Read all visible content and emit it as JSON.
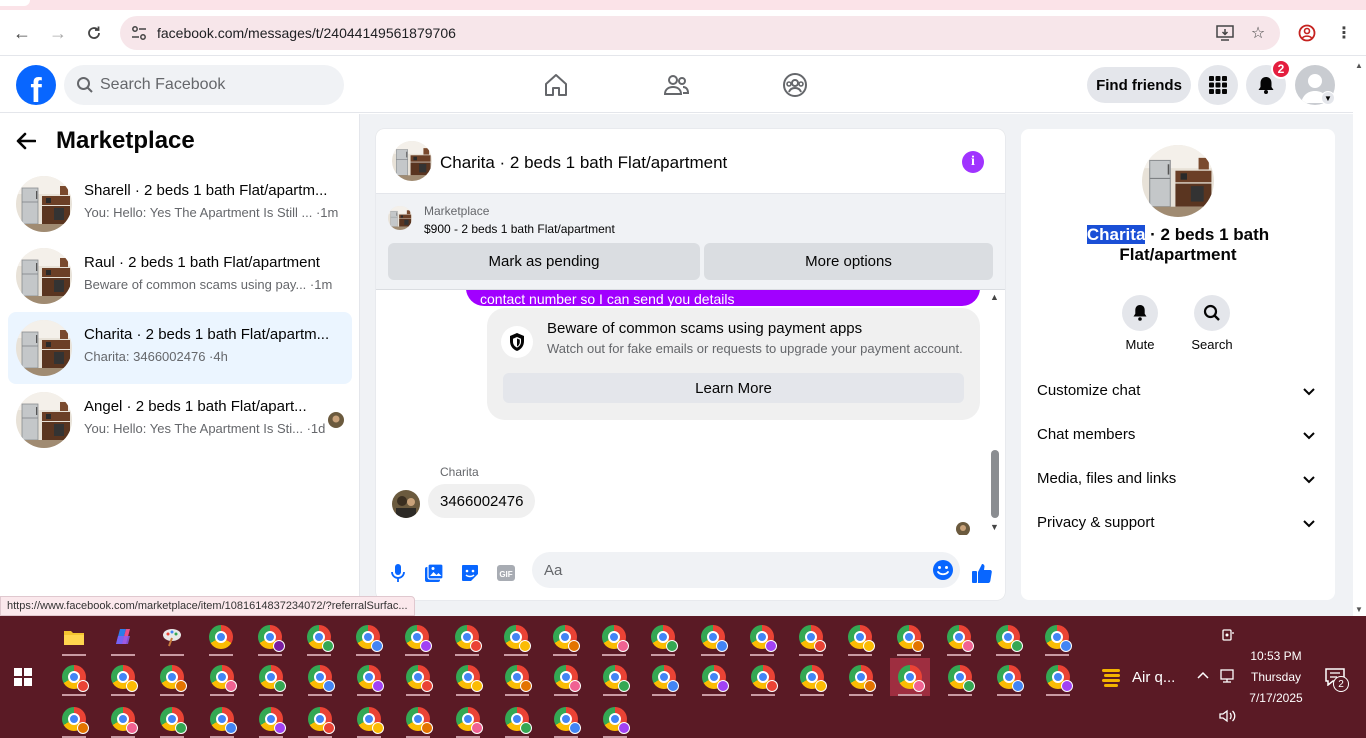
{
  "browser": {
    "url": "facebook.com/messages/t/24044149561879706",
    "status_url": "https://www.facebook.com/marketplace/item/1081614837234072/?referralSurfac..."
  },
  "header": {
    "search_placeholder": "Search Facebook",
    "find_friends_label": "Find friends",
    "notification_count": "2"
  },
  "sidebar": {
    "title": "Marketplace",
    "conversations": [
      {
        "title": "Sharell · 2 beds 1 bath Flat/apartm...",
        "preview": "You: Hello: Yes The Apartment Is Still ... ·1m",
        "active": false
      },
      {
        "title": "Raul · 2 beds 1 bath Flat/apartment",
        "preview": "Beware of common scams using pay... ·1m",
        "active": false
      },
      {
        "title": "Charita · 2 beds 1 bath Flat/apartm...",
        "preview": "Charita: 3466002476 ·4h",
        "active": true
      },
      {
        "title": "Angel · 2 beds 1 bath Flat/apart...",
        "preview": "You: Hello: Yes The Apartment Is Sti... ·1d",
        "active": false
      }
    ]
  },
  "chat": {
    "title": "Charita · 2 beds 1 bath Flat/apartment",
    "banner_label": "Marketplace",
    "listing": "$900 - 2 beds 1 bath Flat/apartment",
    "mark_pending_label": "Mark as pending",
    "more_options_label": "More options",
    "sent_partial": "contact number so I can send you details",
    "scam_title": "Beware of common scams using payment apps",
    "scam_body": "Watch out for fake emails or requests to upgrade your payment account.",
    "learn_more_label": "Learn More",
    "sender_name": "Charita",
    "received_message": "3466002476",
    "composer_placeholder": "Aa"
  },
  "details": {
    "name_highlight": "Charita",
    "name_rest": " · 2 beds 1 bath Flat/apartment",
    "mute_label": "Mute",
    "search_label": "Search",
    "sections": [
      "Customize chat",
      "Chat members",
      "Media, files and links",
      "Privacy & support"
    ]
  },
  "taskbar": {
    "weather": "Air q...",
    "time": "10:53 PM",
    "day": "Thursday",
    "date": "7/17/2025",
    "notification_count": "2"
  },
  "colors": {
    "fb_blue": "#0866ff",
    "messenger_purple": "#a100ff",
    "active_conv_bg": "#ebf5ff",
    "taskbar": "#5a1a25"
  }
}
